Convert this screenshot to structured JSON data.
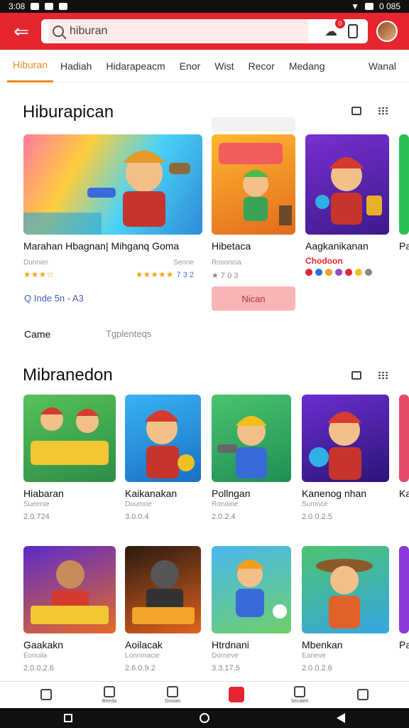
{
  "statusbar": {
    "time": "3:08",
    "right_text": "0 085"
  },
  "search": {
    "value": "hiburan",
    "badge_count": "0"
  },
  "tabs": [
    "Hiburan",
    "Hadiah",
    "Hidarapeacm",
    "Enor",
    "Wist",
    "Recor",
    "Medang",
    "Wanal"
  ],
  "section1": {
    "title": "Hiburapican",
    "link": "Q Inde 5n - A3",
    "button": "Nican",
    "row_left": "Came",
    "row_right": "Tgplenteqs",
    "cards": [
      {
        "title": "Marahan Hbagnan| Mihganq Goma",
        "sub": "Dunnier",
        "sub2": "Senne",
        "rating_text": "7 3 2"
      },
      {
        "title": "Hibetaca",
        "sub": "Rosoncia",
        "meta": "7 0 3"
      },
      {
        "title": "Aagkanikanan",
        "sub": "Chodoon"
      },
      {
        "title": "Pa",
        "sub": ""
      }
    ]
  },
  "section2": {
    "title": "Mibranedon",
    "cards": [
      {
        "title": "Hiabaran",
        "sub": "Sueenie",
        "meta": "2.0.724"
      },
      {
        "title": "Kaikanakan",
        "sub": "Duumne",
        "meta": "3.0.0.4"
      },
      {
        "title": "Pollngan",
        "sub": "Ronoine",
        "meta": "2.0.2.4"
      },
      {
        "title": "Kanenog nhan",
        "sub": "Sumnce",
        "meta": "2.0.0.2.5"
      },
      {
        "title": "Ka",
        "sub": "",
        "meta": ""
      }
    ]
  },
  "section3": {
    "cards": [
      {
        "title": "Gaakakn",
        "sub": "Eonuila",
        "meta": "2.0.0.2.6"
      },
      {
        "title": "Aoilacak",
        "sub": "Lonnmacie",
        "meta": "2.6.0.9.2"
      },
      {
        "title": "Htrdnani",
        "sub": "Dorneve",
        "meta": "3.3.17.5"
      },
      {
        "title": "Mbenkan",
        "sub": "Eaneve",
        "meta": "2.0.0.2.6"
      },
      {
        "title": "Pa",
        "sub": "",
        "meta": ""
      }
    ]
  },
  "bottomnav": [
    "Beeda",
    "Dostan",
    "",
    "Secalen",
    ""
  ]
}
